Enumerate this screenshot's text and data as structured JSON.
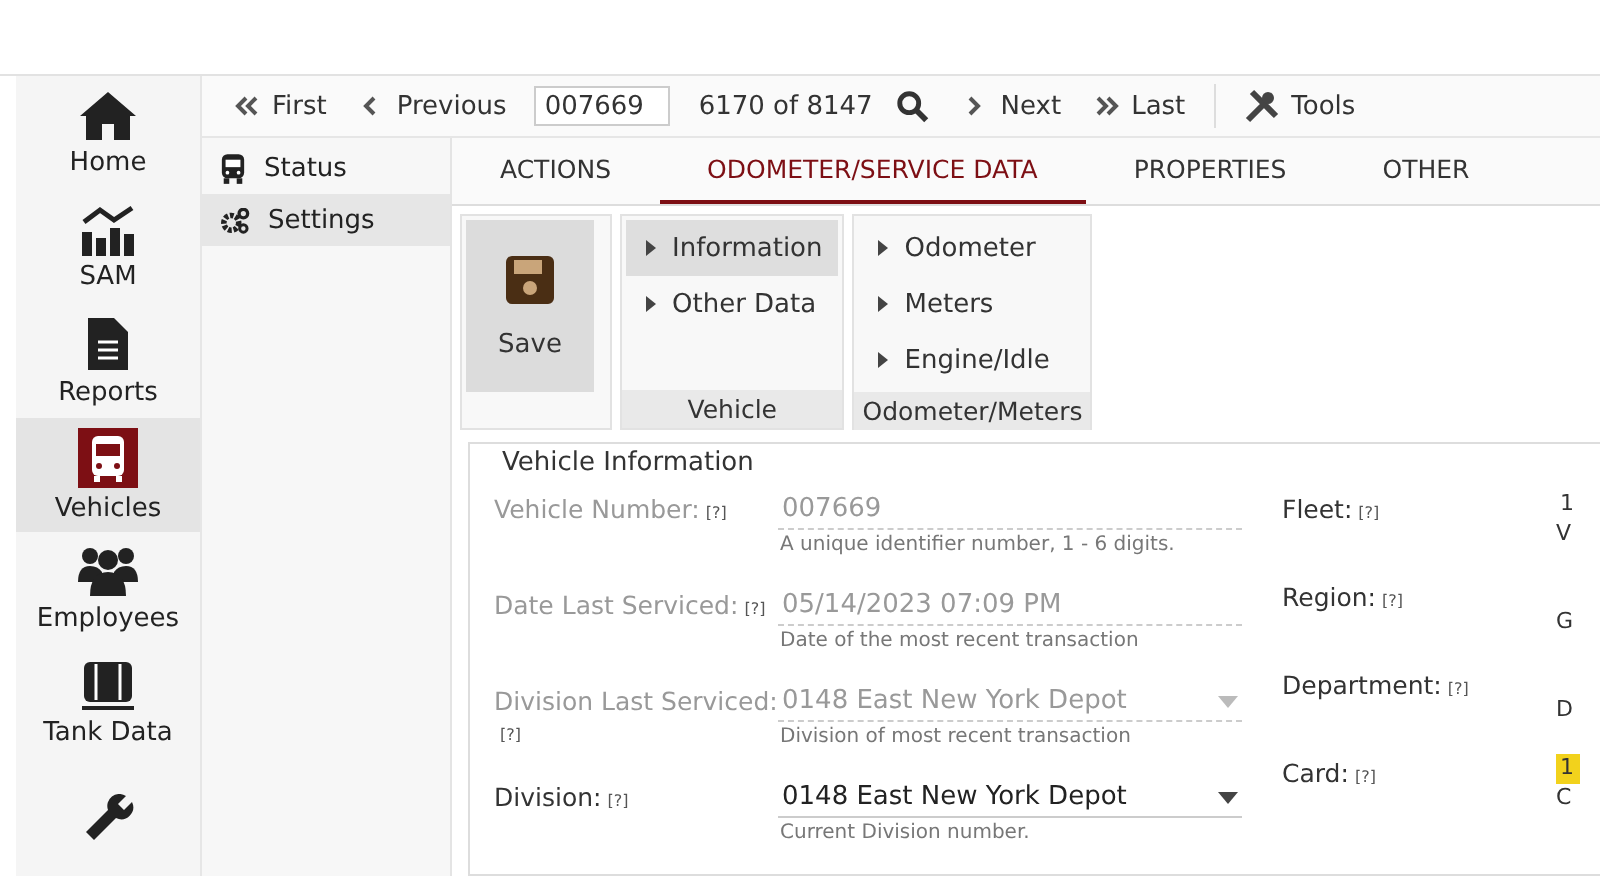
{
  "nav": [
    {
      "kind": "home",
      "label": "Home",
      "selected": false
    },
    {
      "kind": "chart",
      "label": "SAM",
      "selected": false
    },
    {
      "kind": "document",
      "label": "Reports",
      "selected": false
    },
    {
      "kind": "bus",
      "label": "Vehicles",
      "selected": true
    },
    {
      "kind": "people",
      "label": "Employees",
      "selected": false
    },
    {
      "kind": "tank",
      "label": "Tank Data",
      "selected": false
    },
    {
      "kind": "wrench",
      "selected": false
    }
  ],
  "toolbar": {
    "first": "First",
    "previous": "Previous",
    "record": "007669",
    "position": "6170 of 8147",
    "next": "Next",
    "last": "Last",
    "tools": "Tools"
  },
  "subnav": [
    {
      "kind": "bus",
      "label": "Status",
      "selected": false
    },
    {
      "kind": "gears",
      "label": "Settings",
      "selected": true
    }
  ],
  "tabs": [
    {
      "label": "ACTIONS",
      "selected": false
    },
    {
      "label": "ODOMETER/SERVICE DATA",
      "selected": true
    },
    {
      "label": "PROPERTIES",
      "selected": false
    },
    {
      "label": "OTHER",
      "selected": false
    }
  ],
  "ribbon": {
    "save": "Save",
    "groups": [
      {
        "title": "Vehicle",
        "items": [
          {
            "label": "Information",
            "selected": true
          },
          {
            "label": "Other Data",
            "selected": false
          }
        ]
      },
      {
        "title": "Odometer/Meters",
        "items": [
          {
            "label": "Odometer",
            "selected": false
          },
          {
            "label": "Meters",
            "selected": false
          },
          {
            "label": "Engine/Idle",
            "selected": false
          }
        ]
      }
    ]
  },
  "form": {
    "title": "Vehicle Information",
    "fields": [
      {
        "kind": "text",
        "label": "Vehicle Number:",
        "help": "[?]",
        "value": "007669",
        "hint": "A unique identifier number, 1 - 6 digits.",
        "disabled": true
      },
      {
        "kind": "text",
        "label": "Date Last Serviced:",
        "help": "[?]",
        "value": "05/14/2023 07:09 PM",
        "hint": "Date of the most recent transaction",
        "disabled": true
      },
      {
        "kind": "select",
        "label": "Division Last Serviced:",
        "help": "[?]",
        "value": "0148 East New York Depot",
        "hint": "Division of most recent transaction",
        "disabled": true
      },
      {
        "kind": "select",
        "label": "Division:",
        "help": "[?]",
        "value": "0148 East New York Depot",
        "hint": "Current Division number.",
        "disabled": false
      }
    ],
    "right_fields": [
      {
        "label": "Fleet:",
        "help": "[?]",
        "value": "1",
        "hint": "V",
        "highlighted": false
      },
      {
        "label": "Region:",
        "help": "[?]",
        "hint": "G"
      },
      {
        "label": "Department:",
        "help": "[?]",
        "hint": "D"
      },
      {
        "label": "Card:",
        "help": "[?]",
        "value": "1",
        "hint": "C",
        "highlighted": true
      }
    ]
  }
}
